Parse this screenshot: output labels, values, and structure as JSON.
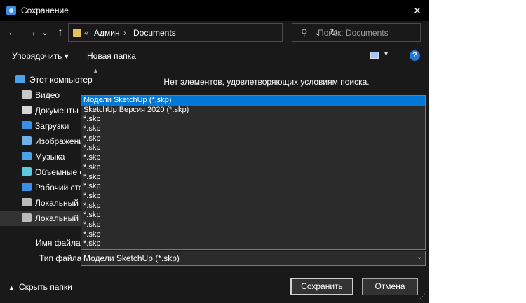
{
  "window": {
    "title": "Сохранение",
    "close": "✕"
  },
  "nav": {
    "back": "←",
    "forward": "→",
    "recent": "⌄",
    "up": "↑",
    "breadcrumb": {
      "sep_start": "«",
      "admin": "Админ",
      "sep": "›",
      "documents": "Documents"
    },
    "addr_dropdown": "⌄",
    "refresh": "↻",
    "search_placeholder": "Поиск: Documents",
    "search_icon": "⚲"
  },
  "toolbar": {
    "organize": "Упорядочить ▾",
    "new_folder": "Новая папка",
    "help": "?",
    "view_dropdown": "▾"
  },
  "sidebar": {
    "scroll_up": "▲",
    "items": [
      {
        "label": "Этот компьютер",
        "icon": "computer-icon",
        "color": "#4aa3e8"
      },
      {
        "label": "Видео",
        "icon": "video-icon",
        "color": "#c8c8c8"
      },
      {
        "label": "Документы",
        "icon": "documents-icon",
        "color": "#d6d6d6"
      },
      {
        "label": "Загрузки",
        "icon": "downloads-icon",
        "color": "#3a8ee6"
      },
      {
        "label": "Изображения",
        "icon": "pictures-icon",
        "color": "#6fb0e8"
      },
      {
        "label": "Музыка",
        "icon": "music-icon",
        "color": "#4aa3e8"
      },
      {
        "label": "Объемные объекты",
        "icon": "3d-objects-icon",
        "color": "#5ec8e0"
      },
      {
        "label": "Рабочий стол",
        "icon": "desktop-icon",
        "color": "#3a8ee6"
      },
      {
        "label": "Локальный диск",
        "icon": "local-disk-icon",
        "color": "#bbbbbb"
      },
      {
        "label": "Локальный диск",
        "icon": "local-disk-icon",
        "color": "#bbbbbb"
      }
    ]
  },
  "content": {
    "empty_message": "Нет элементов, удовлетворяющих условиям поиска."
  },
  "form": {
    "filename_label": "Имя файла:",
    "filetype_label": "Тип файла:",
    "filetype_value": "Модели SketchUp (*.skp)",
    "filetype_chevron": "⌄",
    "filetype_options": [
      "Модели SketchUp (*.skp)",
      "SketchUp Версия 2020 (*.skp)",
      "*.skp",
      "*.skp",
      "*.skp",
      "*.skp",
      "*.skp",
      "*.skp",
      "*.skp",
      "*.skp",
      "*.skp",
      "*.skp",
      "*.skp",
      "*.skp",
      "*.skp",
      "*.skp"
    ]
  },
  "footer": {
    "hide_folders": "Скрыть папки",
    "hide_caret": "▲",
    "save": "Сохранить",
    "cancel": "Отмена"
  }
}
